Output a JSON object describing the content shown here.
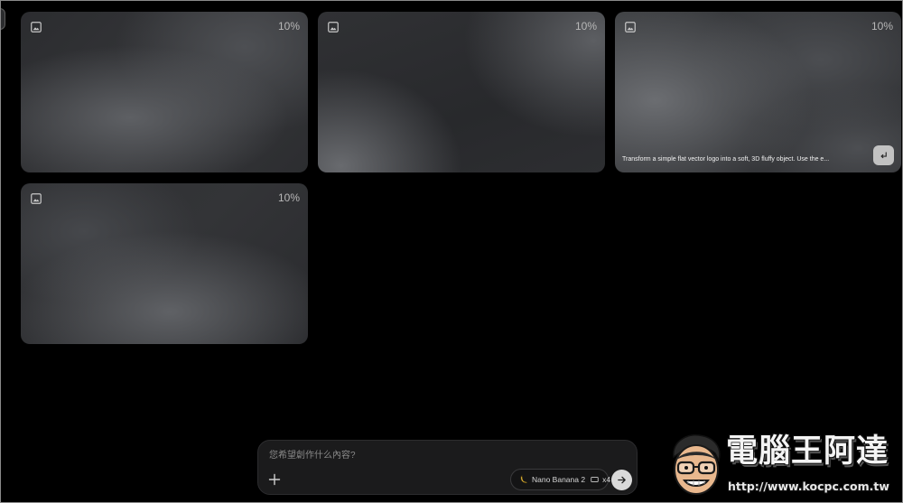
{
  "cards": [
    {
      "type_icon": "image-icon",
      "progress_label": "10%"
    },
    {
      "type_icon": "image-icon",
      "progress_label": "10%"
    },
    {
      "type_icon": "image-icon",
      "progress_label": "10%",
      "prompt": "Transform a simple flat vector logo into a soft, 3D fluffy object. Use the e...",
      "action_icon": "reuse-prompt-icon"
    },
    {
      "type_icon": "image-icon",
      "progress_label": "10%"
    }
  ],
  "composer": {
    "placeholder": "您希望創作什么內容?",
    "add_icon": "plus-icon",
    "model": {
      "icon": "banana-icon",
      "label": "Nano Banana 2"
    },
    "aspect_icon": "aspect-ratio-icon",
    "output_count": "x4",
    "send_icon": "arrow-right-icon"
  },
  "watermark": {
    "title": "電腦王阿達",
    "url": "http://www.kocpc.com.tw"
  },
  "theme": {
    "background": "#000000",
    "card_base": "#2e2f32",
    "send_button": "#d9d9d9"
  }
}
